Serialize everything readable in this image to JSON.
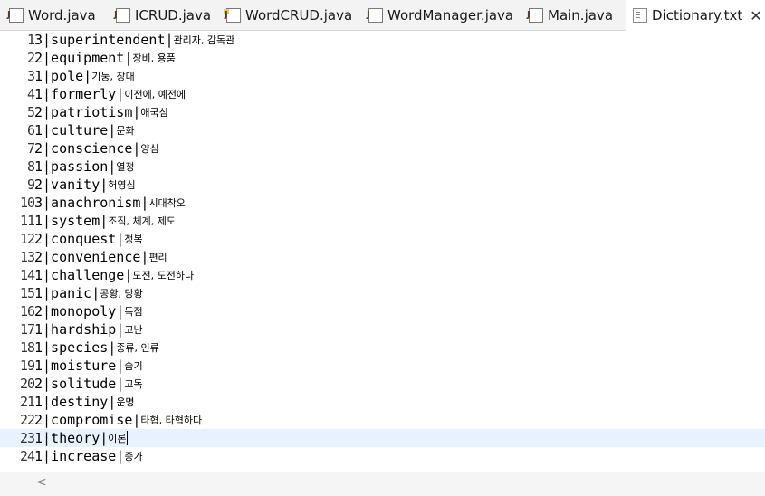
{
  "tabs": [
    {
      "label": "Word.java",
      "icon": "java-file-icon",
      "active": false
    },
    {
      "label": "ICRUD.java",
      "icon": "java-interface-icon",
      "active": false
    },
    {
      "label": "WordCRUD.java",
      "icon": "java-file-icon",
      "active": false
    },
    {
      "label": "WordManager.java",
      "icon": "java-file-icon",
      "active": false
    },
    {
      "label": "Main.java",
      "icon": "java-file-icon",
      "active": false
    },
    {
      "label": "Dictionary.txt",
      "icon": "text-file-icon",
      "active": true,
      "close": "✕"
    }
  ],
  "editor": {
    "lines": [
      {
        "n": "1",
        "text": "3|superintendent|",
        "kor": "관리자, 감독관"
      },
      {
        "n": "2",
        "text": "2|equipment|",
        "kor": "장비, 용품"
      },
      {
        "n": "3",
        "text": "1|pole|",
        "kor": "기둥, 장대"
      },
      {
        "n": "4",
        "text": "1|formerly|",
        "kor": "이전에, 예전에"
      },
      {
        "n": "5",
        "text": "2|patriotism|",
        "kor": "애국심"
      },
      {
        "n": "6",
        "text": "1|culture|",
        "kor": "문화"
      },
      {
        "n": "7",
        "text": "2|conscience|",
        "kor": "양심"
      },
      {
        "n": "8",
        "text": "1|passion|",
        "kor": "열정"
      },
      {
        "n": "9",
        "text": "2|vanity|",
        "kor": "허영심"
      },
      {
        "n": "10",
        "text": "3|anachronism|",
        "kor": "시대착오"
      },
      {
        "n": "11",
        "text": "1|system|",
        "kor": "조직, 체계, 제도"
      },
      {
        "n": "12",
        "text": "2|conquest|",
        "kor": "정복"
      },
      {
        "n": "13",
        "text": "2|convenience|",
        "kor": "편리"
      },
      {
        "n": "14",
        "text": "1|challenge|",
        "kor": "도전, 도전하다"
      },
      {
        "n": "15",
        "text": "1|panic|",
        "kor": "공황, 당황"
      },
      {
        "n": "16",
        "text": "2|monopoly|",
        "kor": "독점"
      },
      {
        "n": "17",
        "text": "1|hardship|",
        "kor": "고난"
      },
      {
        "n": "18",
        "text": "1|species|",
        "kor": "종류, 인류"
      },
      {
        "n": "19",
        "text": "1|moisture|",
        "kor": "습기"
      },
      {
        "n": "20",
        "text": "2|solitude|",
        "kor": "고독"
      },
      {
        "n": "21",
        "text": "1|destiny|",
        "kor": "운명"
      },
      {
        "n": "22",
        "text": "2|compromise|",
        "kor": "타협, 타협하다"
      },
      {
        "n": "23",
        "text": "1|theory|",
        "kor": "이론",
        "current": true
      },
      {
        "n": "24",
        "text": "1|increase|",
        "kor": "증가"
      }
    ]
  },
  "scrollbar": {
    "left_arrow": "<"
  }
}
